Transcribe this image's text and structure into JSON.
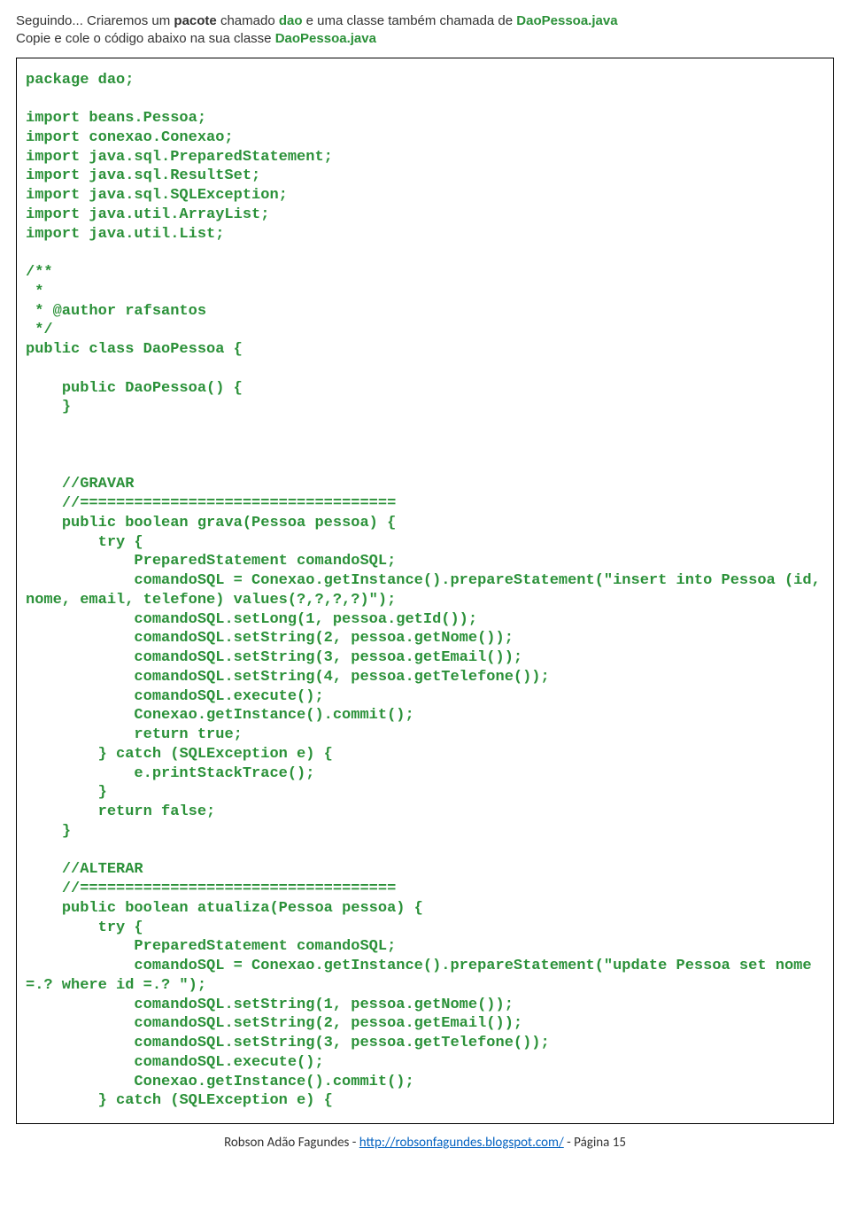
{
  "intro": {
    "t1": "Seguindo... Criaremos um ",
    "t2": "pacote",
    "t3": " chamado ",
    "t4": "dao",
    "t5": " e uma classe também chamada de ",
    "t6": "DaoPessoa.java",
    "t7": "Copie e cole o código abaixo na sua classe ",
    "t8": "DaoPessoa.java"
  },
  "code": "package dao;\n\nimport beans.Pessoa;\nimport conexao.Conexao;\nimport java.sql.PreparedStatement;\nimport java.sql.ResultSet;\nimport java.sql.SQLException;\nimport java.util.ArrayList;\nimport java.util.List;\n\n/**\n *\n * @author rafsantos\n */\npublic class DaoPessoa {\n\n    public DaoPessoa() {\n    }\n\n\n\n    //GRAVAR\n    //===================================\n    public boolean grava(Pessoa pessoa) {\n        try {\n            PreparedStatement comandoSQL;\n            comandoSQL = Conexao.getInstance().prepareStatement(\"insert into Pessoa (id, nome, email, telefone) values(?,?,?,?)\");\n            comandoSQL.setLong(1, pessoa.getId());\n            comandoSQL.setString(2, pessoa.getNome());\n            comandoSQL.setString(3, pessoa.getEmail());\n            comandoSQL.setString(4, pessoa.getTelefone());\n            comandoSQL.execute();\n            Conexao.getInstance().commit();\n            return true;\n        } catch (SQLException e) {\n            e.printStackTrace();\n        }\n        return false;\n    }\n\n    //ALTERAR\n    //===================================\n    public boolean atualiza(Pessoa pessoa) {\n        try {\n            PreparedStatement comandoSQL;\n            comandoSQL = Conexao.getInstance().prepareStatement(\"update Pessoa set nome =.? where id =.? \");\n            comandoSQL.setString(1, pessoa.getNome());\n            comandoSQL.setString(2, pessoa.getEmail());\n            comandoSQL.setString(3, pessoa.getTelefone());\n            comandoSQL.execute();\n            Conexao.getInstance().commit();\n        } catch (SQLException e) {",
  "footer": {
    "author": "Robson Adão Fagundes - ",
    "url": "http://robsonfagundes.blogspot.com/",
    "page": " - Página 15"
  }
}
